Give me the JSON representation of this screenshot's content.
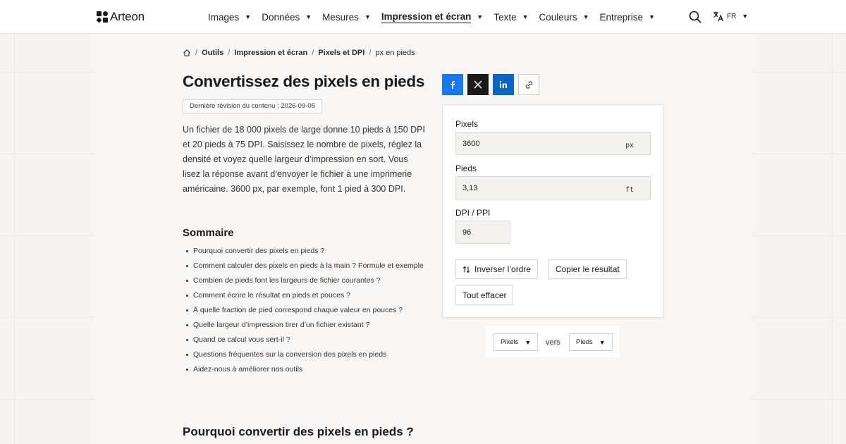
{
  "brand": {
    "name": "Arteon"
  },
  "nav": {
    "items": [
      {
        "label": "Images",
        "active": false
      },
      {
        "label": "Données",
        "active": false
      },
      {
        "label": "Mesures",
        "active": false
      },
      {
        "label": "Impression et écran",
        "active": true
      },
      {
        "label": "Texte",
        "active": false
      },
      {
        "label": "Couleurs",
        "active": false
      },
      {
        "label": "Entreprise",
        "active": false
      }
    ],
    "caret": "▼",
    "search_icon": "search-icon",
    "language": {
      "code": "FR",
      "icon": "translate-icon"
    }
  },
  "breadcrumb": {
    "home_icon": "home-icon",
    "separator": "/",
    "items": [
      "Outils",
      "Impression et écran",
      "Pixels et DPI"
    ],
    "current": "px en pieds"
  },
  "page": {
    "title": "Convertissez des pixels en pieds",
    "revision": "Dernière révision du contenu : 2026-09-05",
    "intro": "Un fichier de 18 000 pixels de large donne 10 pieds à 150 DPI et 20 pieds à 75 DPI. Saisissez le nombre de pixels, réglez la densité et voyez quelle largeur d’impression en sort. Vous lisez la réponse avant d’envoyer le fichier à une imprimerie américaine. 3600 px, par exemple, font 1 pied à 300 DPI.",
    "summary_title": "Sommaire",
    "toc": [
      "Pourquoi convertir des pixels en pieds ?",
      "Comment calculer des pixels en pieds à la main ? Formule et exemple",
      "Combien de pieds font les largeurs de fichier courantes ?",
      "Comment écrire le résultat en pieds et pouces ?",
      "À quelle fraction de pied correspond chaque valeur en pouces ?",
      "Quelle largeur d’impression tirer d’un fichier existant ?",
      "Quand ce calcul vous sert-il ?",
      "Questions fréquentes sur la conversion des pixels en pieds",
      "Aidez-nous à améliorer nos outils"
    ],
    "section_heading": "Pourquoi convertir des pixels en pieds ?"
  },
  "share": {
    "buttons": [
      "facebook-icon",
      "x-icon",
      "linkedin-icon",
      "link-icon"
    ],
    "colors": {
      "facebook": "#1877f2",
      "x": "#1a1a1a",
      "linkedin": "#0a66c2"
    }
  },
  "calculator": {
    "pixels": {
      "label": "Pixels",
      "value": "3600",
      "unit": "px"
    },
    "feet": {
      "label": "Pieds",
      "value": "3,13",
      "unit": "ft"
    },
    "dpi": {
      "label": "DPI / PPI",
      "value": "96"
    },
    "swap_label": "Inverser l’ordre",
    "swap_icon": "swap-vertical-icon",
    "copy_label": "Copier le résultat",
    "clear_label": "Tout effacer"
  },
  "unit_selector": {
    "from": "Pixels",
    "connector": "vers",
    "to": "Pieds",
    "caret": "▼"
  }
}
